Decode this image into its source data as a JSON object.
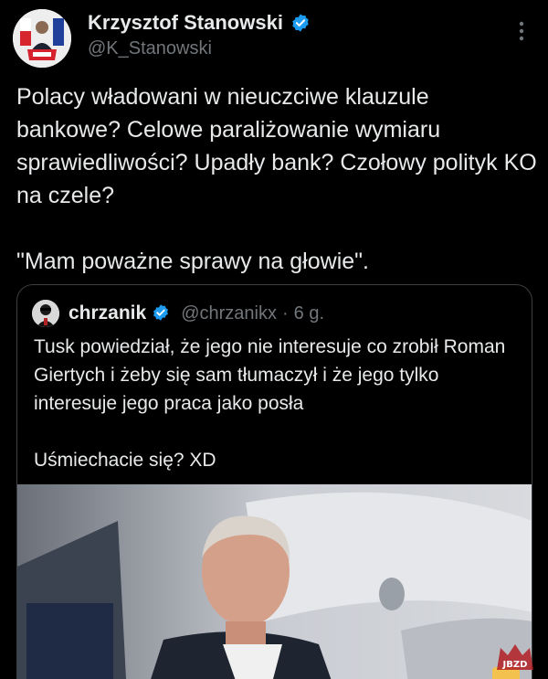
{
  "tweet": {
    "author_name": "Krzysztof Stanowski",
    "author_handle": "@K_Stanowski",
    "avatar_icon": "profile-avatar-icon",
    "verified_icon": "verified-badge-icon",
    "more_icon": "more-options-icon",
    "text": "Polacy władowani w nieuczciwe klauzule bankowe? Celowe paraliżowanie wymiaru sprawiedliwości? Upadły bank? Czołowy polityk KO na czele?\n\n\"Mam poważne sprawy na głowie\"."
  },
  "quote": {
    "author_name": "chrzanik",
    "author_handle": "@chrzanikx",
    "separator": "·",
    "time": "6 g.",
    "text": "Tusk powiedział, że jego nie interesuje co zrobił Roman Giertych i żeby się sam tłumaczył i że jego tylko interesuje jego praca jako posła\n\nUśmiechacie się? XD",
    "media_icon": "video-thumbnail-image"
  },
  "watermark": {
    "text": "JBZD",
    "icon": "watermark-logo-icon"
  },
  "colors": {
    "background": "#000000",
    "primary_text": "#e7e9ea",
    "secondary_text": "#71767b",
    "verified": "#1d9bf0",
    "border": "#3c4043"
  }
}
